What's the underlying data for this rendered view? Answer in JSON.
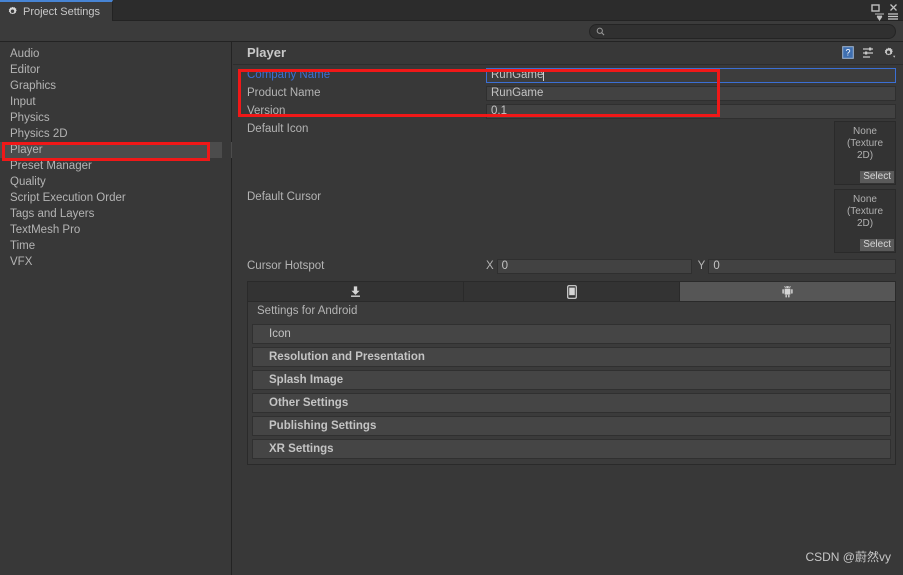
{
  "window": {
    "tab_label": "Project Settings",
    "tab_icon": "gear-icon",
    "maximize_icon": "maximize-icon",
    "close_icon": "close-icon",
    "dropdown_icon": "dropdown-icon",
    "menu_icon": "hamburger-menu-icon",
    "accent_color": "#4784d4"
  },
  "search": {
    "icon": "search-icon",
    "value": "",
    "placeholder": ""
  },
  "sidebar": {
    "items": [
      {
        "label": "Audio",
        "selected": false
      },
      {
        "label": "Editor",
        "selected": false
      },
      {
        "label": "Graphics",
        "selected": false
      },
      {
        "label": "Input",
        "selected": false
      },
      {
        "label": "Physics",
        "selected": false
      },
      {
        "label": "Physics 2D",
        "selected": false
      },
      {
        "label": "Player",
        "selected": true
      },
      {
        "label": "Preset Manager",
        "selected": false
      },
      {
        "label": "Quality",
        "selected": false
      },
      {
        "label": "Script Execution Order",
        "selected": false
      },
      {
        "label": "Tags and Layers",
        "selected": false
      },
      {
        "label": "TextMesh Pro",
        "selected": false
      },
      {
        "label": "Time",
        "selected": false
      },
      {
        "label": "VFX",
        "selected": false
      }
    ]
  },
  "main": {
    "title": "Player",
    "header_icons": [
      {
        "name": "help-icon"
      },
      {
        "name": "preset-icon"
      },
      {
        "name": "gear-dropdown-icon"
      }
    ],
    "properties": [
      {
        "label": "Company Name",
        "value": "RunGame",
        "modified": true,
        "focused": true
      },
      {
        "label": "Product Name",
        "value": "RunGame",
        "modified": false,
        "focused": false
      },
      {
        "label": "Version",
        "value": "0.1",
        "modified": false,
        "focused": false
      }
    ],
    "texture_fields": [
      {
        "label": "Default Icon",
        "value_line1": "None",
        "value_line2": "(Texture",
        "value_line3": "2D)",
        "select_label": "Select"
      },
      {
        "label": "Default Cursor",
        "value_line1": "None",
        "value_line2": "(Texture",
        "value_line3": "2D)",
        "select_label": "Select"
      }
    ],
    "cursor_hotspot": {
      "label": "Cursor Hotspot",
      "x_label": "X",
      "x_value": "0",
      "y_label": "Y",
      "y_value": "0"
    },
    "platform_tabs": [
      {
        "icon": "standalone-download-icon",
        "active": false
      },
      {
        "icon": "ios-phone-icon",
        "active": false
      },
      {
        "icon": "android-robot-icon",
        "active": true
      }
    ],
    "settings_for": "Settings for Android",
    "sections": [
      {
        "label": "Icon",
        "bold": false
      },
      {
        "label": "Resolution and Presentation",
        "bold": true
      },
      {
        "label": "Splash Image",
        "bold": true
      },
      {
        "label": "Other Settings",
        "bold": true
      },
      {
        "label": "Publishing Settings",
        "bold": true
      },
      {
        "label": "XR Settings",
        "bold": true
      }
    ]
  },
  "annotations": {
    "highlight_color": "#f01818",
    "boxes": [
      {
        "name": "sidebar-player-highlight"
      },
      {
        "name": "company-product-name-highlight"
      }
    ]
  },
  "watermark": {
    "text": "CSDN @蔚然vy"
  }
}
